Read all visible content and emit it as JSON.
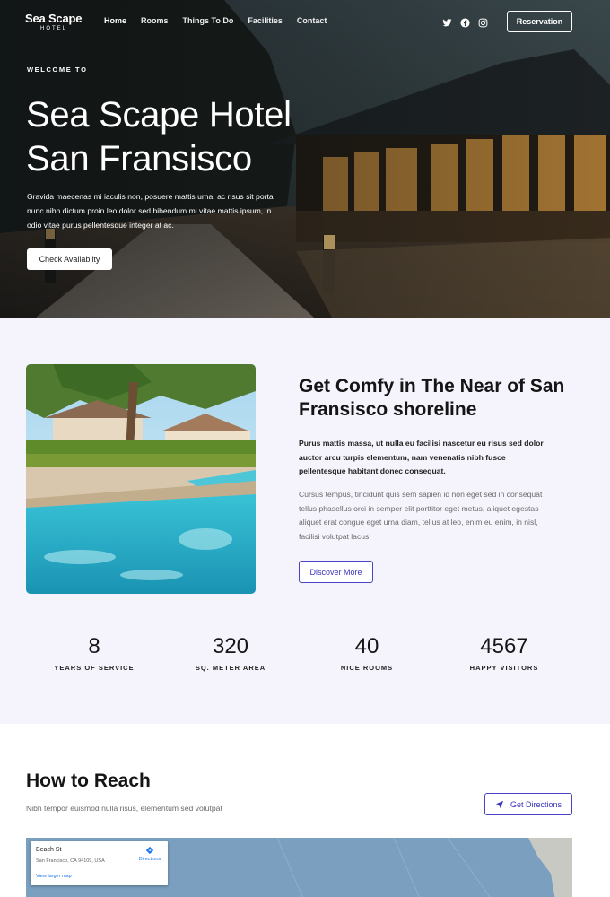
{
  "header": {
    "logo_main": "Sea Scape",
    "logo_sub": "HOTEL",
    "menu": [
      {
        "label": "Home"
      },
      {
        "label": "Rooms"
      },
      {
        "label": "Things To Do"
      },
      {
        "label": "Facilities"
      },
      {
        "label": "Contact"
      }
    ],
    "social_icons": [
      "twitter-icon",
      "facebook-icon",
      "instagram-icon"
    ],
    "reservation_label": "Reservation"
  },
  "hero": {
    "eyebrow": "WELCOME TO",
    "title_line1": "Sea Scape Hotel",
    "title_line2": "San Fransisco",
    "text": "Gravida maecenas mi iaculis non, posuere mattis urna, ac risus sit porta nunc nibh dictum proin leo dolor sed bibendum mi vitae mattis ipsum, in odio vitae purus pellentesque integer at ac.",
    "cta_label": "Check Availabilty"
  },
  "about": {
    "title": "Get Comfy in The Near of San Fransisco shoreline",
    "lead": "Purus mattis massa, ut nulla eu facilisi nascetur eu risus sed dolor auctor arcu turpis elementum, nam venenatis nibh fusce pellentesque habitant donec consequat.",
    "body": "Cursus tempus, tincidunt quis sem sapien id non eget sed in consequat tellus phasellus orci in semper elit porttitor eget metus, aliquet egestas aliquet erat congue eget urna diam, tellus at leo, enim eu enim, in nisl, facilisi volutpat lacus.",
    "button_label": "Discover More"
  },
  "stats": [
    {
      "value": "8",
      "label": "YEARS OF SERVICE"
    },
    {
      "value": "320",
      "label": "SQ. METER AREA"
    },
    {
      "value": "40",
      "label": "NICE ROOMS"
    },
    {
      "value": "4567",
      "label": "HAPPY VISITORS"
    }
  ],
  "reach": {
    "title": "How to Reach",
    "subtitle": "Nibh tempor euismod nulla risus, elementum sed volutpat",
    "button_label": "Get Directions",
    "map": {
      "place_name": "Beach St",
      "address": "San Francisco, CA 94109, USA",
      "directions_label": "Directions",
      "larger_map_label": "View larger map"
    }
  },
  "colors": {
    "accent": "#3b33b8",
    "section_bg": "#f5f4fd",
    "map_water": "#7a9fbf"
  }
}
